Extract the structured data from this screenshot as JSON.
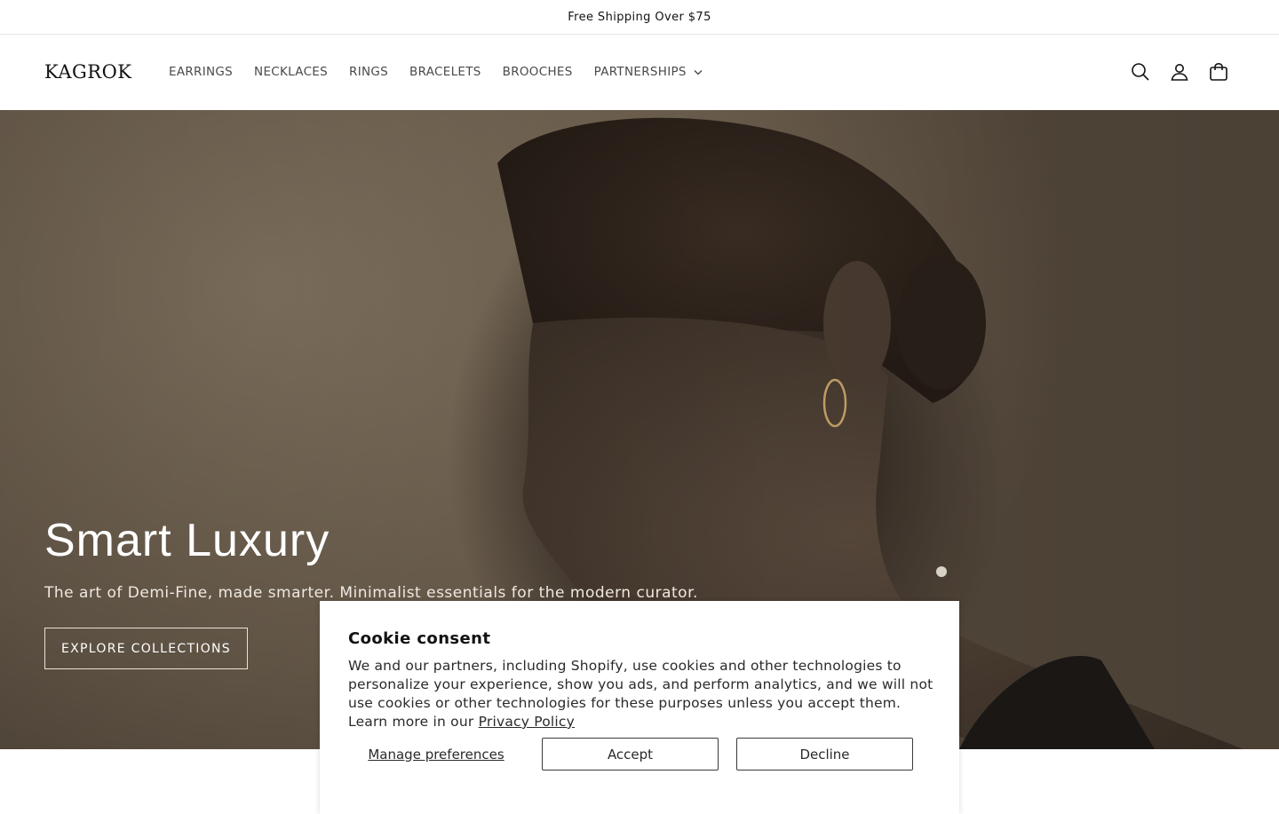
{
  "announcement": {
    "text": "Free Shipping Over $75"
  },
  "header": {
    "logo": "KAGROK",
    "nav": [
      {
        "label": "EARRINGS"
      },
      {
        "label": "NECKLACES"
      },
      {
        "label": "RINGS"
      },
      {
        "label": "BRACELETS"
      },
      {
        "label": "BROOCHES"
      },
      {
        "label": "PARTNERSHIPS",
        "icon": "chevron-down-icon"
      }
    ],
    "icons": [
      "search-icon",
      "account-icon",
      "cart-icon"
    ]
  },
  "hero": {
    "title": "Smart Luxury",
    "subtitle": "The art of Demi-Fine, made smarter. Minimalist essentials for the modern curator.",
    "cta_label": "EXPLORE COLLECTIONS"
  },
  "cookie_banner": {
    "title": "Cookie consent",
    "text": "We and our partners, including Shopify, use cookies and other technologies to personalize your experience, show you ads, and perform analytics, and we will not use cookies or other technologies for these purposes unless you accept them. Learn more in our ",
    "link_label": "Privacy Policy",
    "manage_label": "Manage preferences",
    "accept_label": "Accept",
    "decline_label": "Decline"
  },
  "colors": {
    "text": "#121212",
    "nav_text": "#4a4a4a",
    "hero_bg": "#6f6150",
    "white": "#ffffff"
  }
}
